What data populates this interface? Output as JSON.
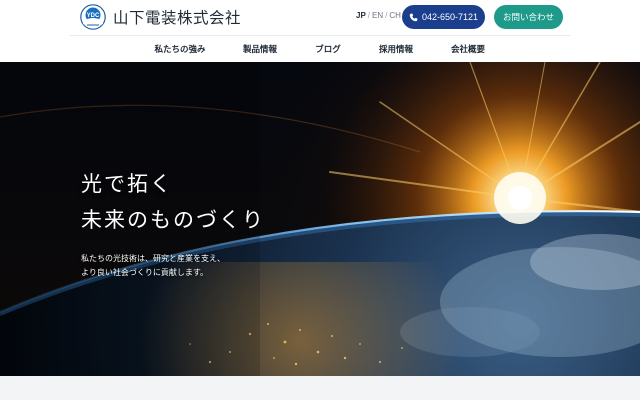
{
  "header": {
    "logo_text": "YDC",
    "company_name": "山下電装株式会社",
    "languages": [
      "JP",
      "EN",
      "CH"
    ],
    "language_active": "JP",
    "phone_label": "042-650-7121",
    "contact_label": "お問い合わせ",
    "colors": {
      "phone_button": "#1b3e8d",
      "contact_button": "#1d9a8a"
    }
  },
  "nav": {
    "items": [
      {
        "label": "私たちの強み"
      },
      {
        "label": "製品情報"
      },
      {
        "label": "ブログ"
      },
      {
        "label": "採用情報"
      },
      {
        "label": "会社概要"
      }
    ]
  },
  "hero": {
    "title_line1": "光で拓く",
    "title_line2": "未来のものづくり",
    "subtitle_line1": "私たちの光技術は、研究と産業を支え、",
    "subtitle_line2": "より良い社会づくりに貢献します。"
  }
}
